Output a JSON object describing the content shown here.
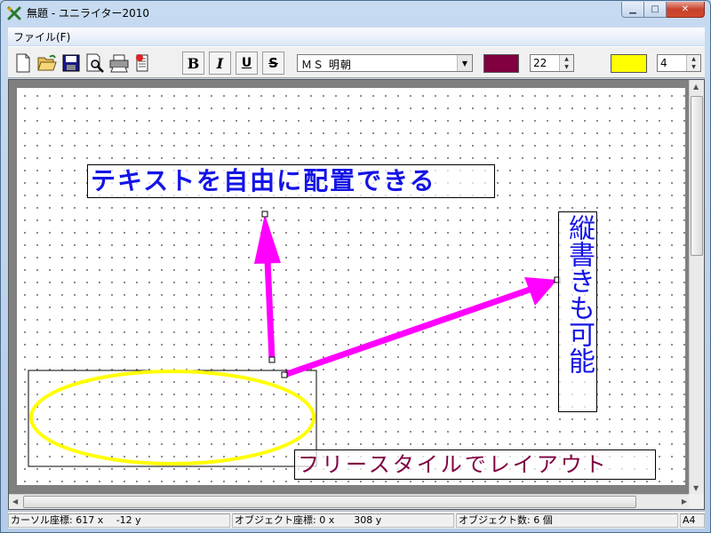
{
  "window": {
    "title": "無題 - ユニライター2010"
  },
  "menu": {
    "file": "ファイル(F)"
  },
  "toolbar": {
    "buttons": [
      "new-document",
      "open-folder",
      "save",
      "print-preview",
      "print",
      "properties"
    ],
    "bold": "B",
    "italic": "I",
    "underline": "U",
    "strikethrough": "S",
    "font": "ＭＳ 明朝",
    "text_color": "#800040",
    "font_size": "22",
    "fill_color": "#ffff00",
    "line_width": "4"
  },
  "canvas": {
    "text_horizontal": "テキストを自由に配置できる",
    "text_vertical": "縦書きも可能",
    "text_freestyle": "フリースタイルでレイアウト",
    "arrow_color": "#ff00ff",
    "ellipse_color": "#ffff00"
  },
  "status": {
    "cursor": "カーソル座標: 617 x　 -12 y",
    "object_coord": "オブジェクト座標: 0 x　　308 y",
    "object_count": "オブジェクト数: 6 個",
    "paper": "A4"
  }
}
